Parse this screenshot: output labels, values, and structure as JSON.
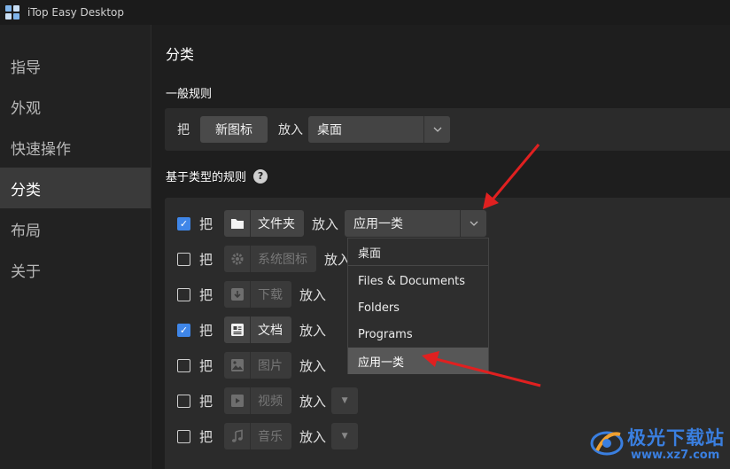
{
  "window": {
    "title": "iTop Easy Desktop"
  },
  "sidebar": {
    "items": [
      {
        "label": "指导",
        "active": false
      },
      {
        "label": "外观",
        "active": false
      },
      {
        "label": "快速操作",
        "active": false
      },
      {
        "label": "分类",
        "active": true
      },
      {
        "label": "布局",
        "active": false
      },
      {
        "label": "关于",
        "active": false
      }
    ]
  },
  "main": {
    "title": "分类",
    "general": {
      "heading": "一般规则",
      "prefix": "把",
      "item_button": "新图标",
      "put_label": "放入",
      "target_value": "桌面"
    },
    "type_rules": {
      "heading": "基于类型的规则",
      "help_glyph": "?",
      "prefix": "把",
      "put_label": "放入",
      "rows": [
        {
          "checked": true,
          "type": "文件夹",
          "icon": "folder-icon",
          "enabled": true,
          "target": "应用一类"
        },
        {
          "checked": false,
          "type": "系统图标",
          "icon": "gear-icon",
          "enabled": false
        },
        {
          "checked": false,
          "type": "下载",
          "icon": "download-icon",
          "enabled": false
        },
        {
          "checked": true,
          "type": "文档",
          "icon": "document-icon",
          "enabled": true
        },
        {
          "checked": false,
          "type": "图片",
          "icon": "image-icon",
          "enabled": false
        },
        {
          "checked": false,
          "type": "视频",
          "icon": "video-icon",
          "enabled": false
        },
        {
          "checked": false,
          "type": "音乐",
          "icon": "music-icon",
          "enabled": false
        }
      ],
      "dropdown": {
        "options": [
          "桌面",
          "Files & Documents",
          "Folders",
          "Programs",
          "应用一类"
        ],
        "selected": "应用一类"
      }
    }
  },
  "watermark": {
    "text": "极光下载站",
    "url": "www.xz7.com"
  },
  "colors": {
    "accent": "#3f86e8",
    "annotation_arrow": "#e02020",
    "active_nav": "#3a3a3a"
  }
}
